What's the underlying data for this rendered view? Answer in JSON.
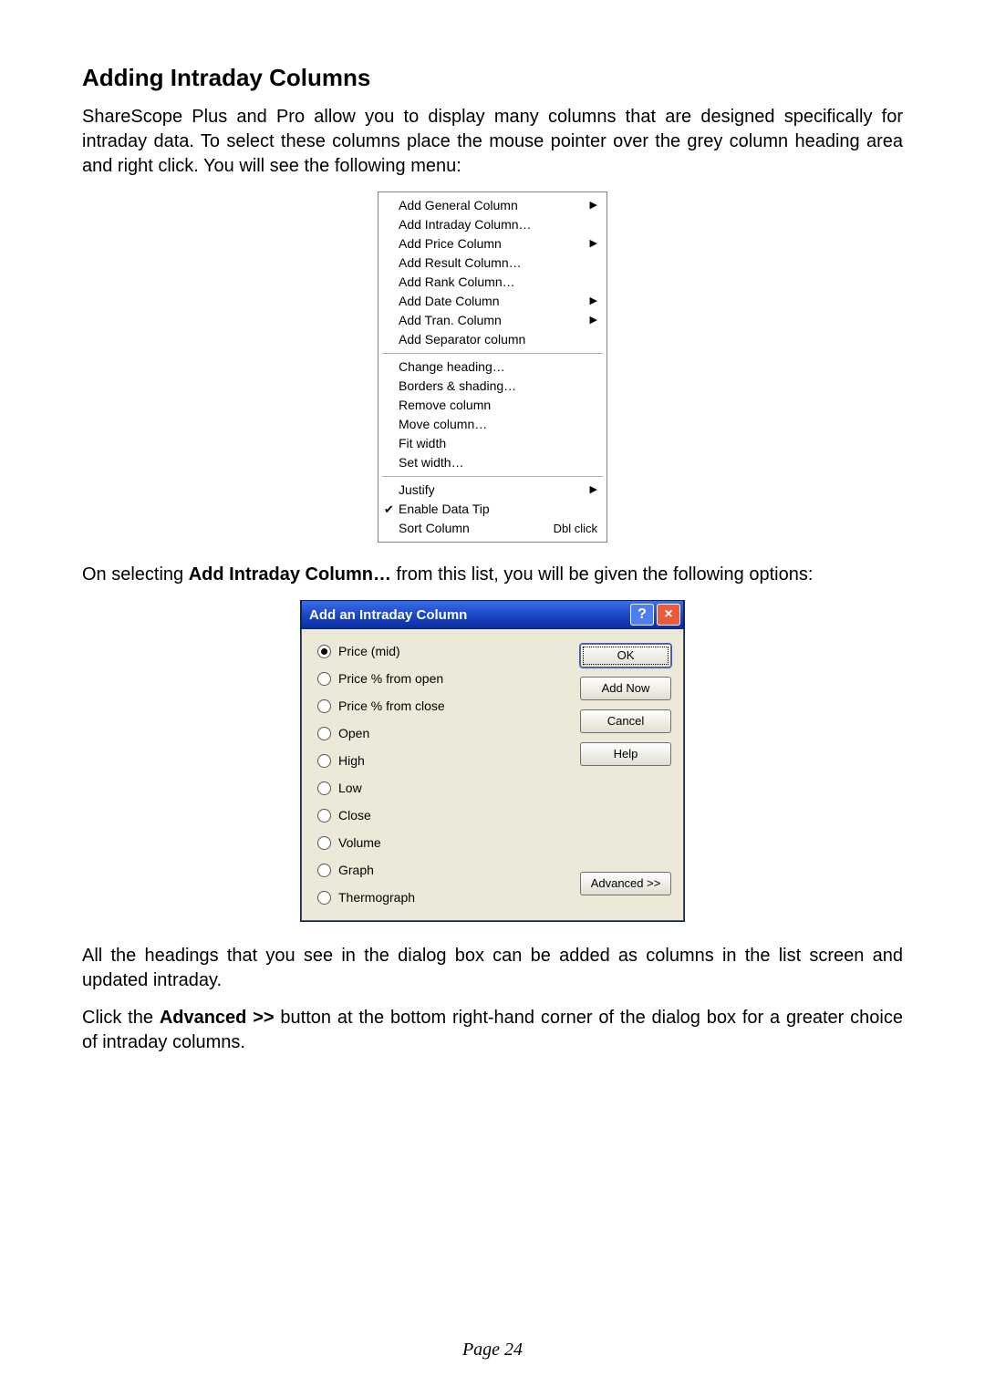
{
  "heading": "Adding Intraday Columns",
  "para1": "ShareScope Plus and Pro allow you to display many columns that are designed specifically for intraday data. To select these columns place the mouse pointer over the grey column heading area and right click. You will see the following menu:",
  "context_menu": {
    "groups": [
      [
        {
          "label": "Add General Column",
          "arrow": true
        },
        {
          "label": "Add Intraday Column…"
        },
        {
          "label": "Add Price Column",
          "arrow": true
        },
        {
          "label": "Add Result Column…"
        },
        {
          "label": "Add Rank Column…"
        },
        {
          "label": "Add Date Column",
          "arrow": true
        },
        {
          "label": "Add Tran. Column",
          "arrow": true
        },
        {
          "label": "Add Separator column"
        }
      ],
      [
        {
          "label": "Change heading…"
        },
        {
          "label": "Borders & shading…"
        },
        {
          "label": "Remove column"
        },
        {
          "label": "Move column…"
        },
        {
          "label": "Fit width"
        },
        {
          "label": "Set width…"
        }
      ],
      [
        {
          "label": "Justify",
          "arrow": true
        },
        {
          "label": "Enable Data Tip",
          "check": true
        },
        {
          "label": "Sort Column",
          "shortcut": "Dbl click"
        }
      ]
    ]
  },
  "para2_pre": "On selecting ",
  "para2_bold": "Add Intraday Column…",
  "para2_post": " from this list, you will be given the following options:",
  "dialog": {
    "title": "Add an Intraday Column",
    "options": [
      {
        "label": "Price (mid)",
        "selected": true
      },
      {
        "label": "Price % from open"
      },
      {
        "label": "Price % from close"
      },
      {
        "label": "Open"
      },
      {
        "label": "High"
      },
      {
        "label": "Low"
      },
      {
        "label": "Close"
      },
      {
        "label": "Volume"
      },
      {
        "label": "Graph"
      },
      {
        "label": "Thermograph"
      }
    ],
    "buttons": {
      "ok": "OK",
      "add_now": "Add Now",
      "cancel": "Cancel",
      "help": "Help",
      "advanced": "Advanced >>"
    }
  },
  "para3": "All the headings that you see in the dialog box can be added as columns in the list screen and updated intraday.",
  "para4_pre": "Click the ",
  "para4_bold": "Advanced >>",
  "para4_post": " button at the bottom right-hand corner of the dialog box for a greater choice of intraday columns.",
  "footer": "Page 24"
}
